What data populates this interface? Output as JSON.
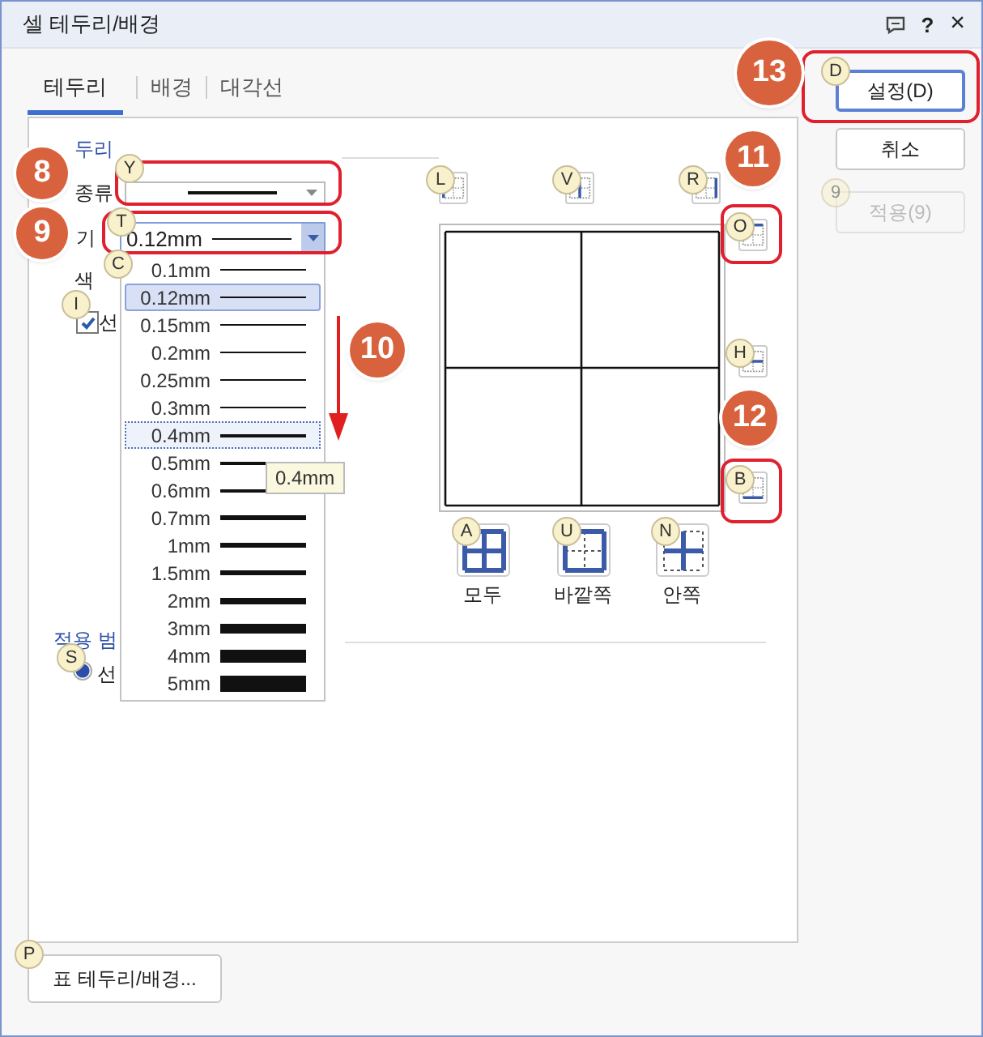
{
  "window": {
    "title": "셀 테두리/배경",
    "help": "?",
    "close": "×"
  },
  "tabs": [
    {
      "label": "테두리",
      "selected": true
    },
    {
      "label": "배경",
      "selected": false
    },
    {
      "label": "대각선",
      "selected": false
    }
  ],
  "border": {
    "section": "두리",
    "type": {
      "label": "종류",
      "key": "Y"
    },
    "width": {
      "label": "기",
      "key": "T",
      "value": "0.12mm"
    },
    "color_key": "C",
    "color": {
      "label": "색"
    },
    "line_check": {
      "label": "선",
      "checked": true,
      "key": "I"
    }
  },
  "width_options": [
    {
      "label": "0.1mm",
      "selected": false,
      "focused": false
    },
    {
      "label": "0.12mm",
      "selected": true,
      "focused": false
    },
    {
      "label": "0.15mm",
      "selected": false,
      "focused": false
    },
    {
      "label": "0.2mm",
      "selected": false,
      "focused": false
    },
    {
      "label": "0.25mm",
      "selected": false,
      "focused": false
    },
    {
      "label": "0.3mm",
      "selected": false,
      "focused": false
    },
    {
      "label": "0.4mm",
      "selected": false,
      "focused": true
    },
    {
      "label": "0.5mm",
      "selected": false,
      "focused": false
    },
    {
      "label": "0.6mm",
      "selected": false,
      "focused": false
    },
    {
      "label": "0.7mm",
      "selected": false,
      "focused": false
    },
    {
      "label": "1mm",
      "selected": false,
      "focused": false
    },
    {
      "label": "1.5mm",
      "selected": false,
      "focused": false
    },
    {
      "label": "2mm",
      "selected": false,
      "focused": false
    },
    {
      "label": "3mm",
      "selected": false,
      "focused": false
    },
    {
      "label": "4mm",
      "selected": false,
      "focused": false
    },
    {
      "label": "5mm",
      "selected": false,
      "focused": false
    }
  ],
  "tooltip": "0.4mm",
  "preview": {
    "edge_buttons": [
      {
        "key": "L",
        "kind": "left"
      },
      {
        "key": "V",
        "kind": "vertical"
      },
      {
        "key": "R",
        "kind": "right"
      },
      {
        "key": "O",
        "kind": "top"
      },
      {
        "key": "H",
        "kind": "horizontal"
      },
      {
        "key": "B",
        "kind": "bottom"
      }
    ],
    "presets": [
      {
        "label": "모두",
        "key": "A",
        "kind": "all"
      },
      {
        "label": "바깥쪽",
        "key": "U",
        "kind": "outer"
      },
      {
        "label": "안쪽",
        "key": "N",
        "kind": "inner"
      }
    ]
  },
  "scope": {
    "section": "적용 범",
    "key": "S",
    "option": {
      "label": "선",
      "selected": true
    }
  },
  "buttons": [
    {
      "label": "설정(D)",
      "key": "D",
      "kind": "default",
      "disabled": false
    },
    {
      "label": "취소",
      "kind": "normal",
      "disabled": false
    },
    {
      "label": "적용(9)",
      "key": "9",
      "kind": "normal",
      "disabled": true
    }
  ],
  "table_button": {
    "label": "표 테두리/배경...",
    "key": "P"
  },
  "annotations": [
    {
      "label": "8"
    },
    {
      "label": "9"
    },
    {
      "label": "10"
    },
    {
      "label": "11"
    },
    {
      "label": "12"
    },
    {
      "label": "13"
    }
  ]
}
